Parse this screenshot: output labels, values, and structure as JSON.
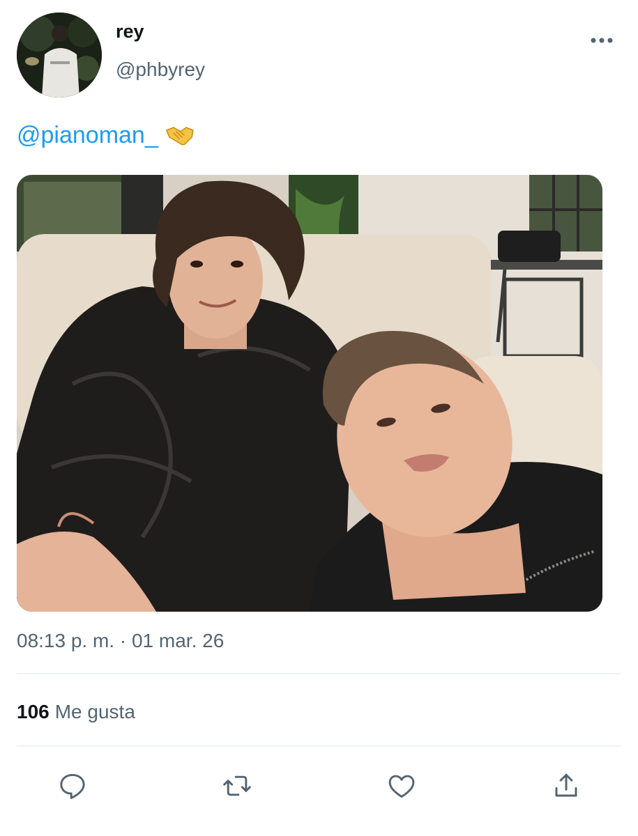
{
  "user": {
    "display_name": "rey",
    "handle": "@phbyrey",
    "avatar_icon": "avatar-photo"
  },
  "tweet": {
    "mention": "@pianoman_",
    "emoji": "🤝",
    "emoji_icon": "handshake-icon",
    "media_icon": "photo"
  },
  "meta": {
    "timestamp": "08:13 p. m. · 01 mar. 26"
  },
  "stats": {
    "likes_count": "106",
    "likes_label": "Me gusta"
  },
  "actions": [
    "reply-icon",
    "retweet-icon",
    "like-icon",
    "share-icon"
  ],
  "colors": {
    "link": "#1d9bf0",
    "secondary_text": "#536471",
    "primary_text": "#0f1419",
    "divider": "#eff3f4"
  }
}
